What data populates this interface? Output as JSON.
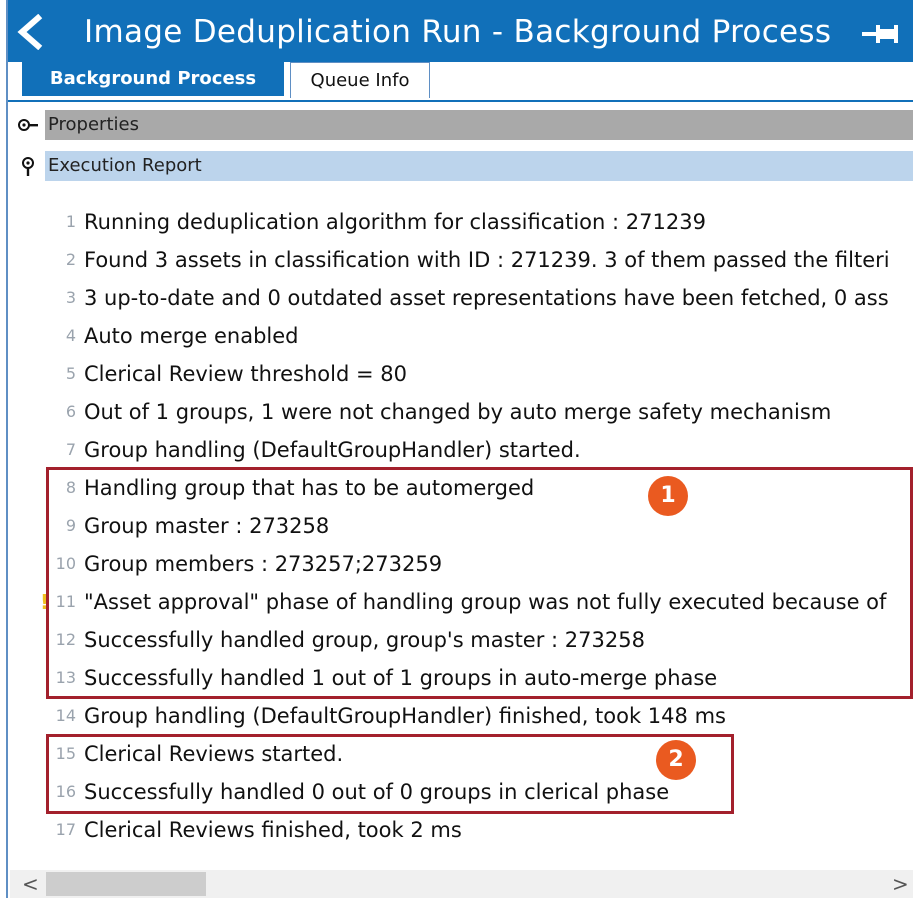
{
  "window": {
    "title": "Image Deduplication Run - Background Process"
  },
  "tabs": [
    {
      "label": "Background Process",
      "active": true
    },
    {
      "label": "Queue Info",
      "active": false
    }
  ],
  "sections": {
    "properties": {
      "label": "Properties",
      "expanded": false
    },
    "execution_report": {
      "label": "Execution Report",
      "expanded": true
    }
  },
  "report_lines": [
    {
      "num": "1",
      "text": "Running deduplication algorithm for classification : 271239"
    },
    {
      "num": "2",
      "text": "Found 3 assets in classification with ID : 271239. 3 of them passed the filteri"
    },
    {
      "num": "3",
      "text": "3 up-to-date and 0 outdated asset representations have been fetched, 0 ass"
    },
    {
      "num": "4",
      "text": "Auto merge enabled"
    },
    {
      "num": "5",
      "text": "Clerical Review threshold = 80"
    },
    {
      "num": "6",
      "text": "Out of 1 groups, 1 were not changed by auto merge safety mechanism"
    },
    {
      "num": "7",
      "text": "Group handling (DefaultGroupHandler) started."
    },
    {
      "num": "8",
      "text": "Handling group that has to be automerged"
    },
    {
      "num": "9",
      "text": "Group master : 273258"
    },
    {
      "num": "10",
      "text": "Group members : 273257;273259"
    },
    {
      "num": "11",
      "text": "\"Asset approval\" phase of handling group was not fully executed because of",
      "warning": "!"
    },
    {
      "num": "12",
      "text": "Successfully handled group, group's master : 273258"
    },
    {
      "num": "13",
      "text": "Successfully handled 1 out of 1 groups in auto-merge phase"
    },
    {
      "num": "14",
      "text": "Group handling (DefaultGroupHandler) finished, took 148 ms"
    },
    {
      "num": "15",
      "text": "Clerical Reviews started."
    },
    {
      "num": "16",
      "text": "Successfully handled 0 out of 0 groups in clerical phase"
    },
    {
      "num": "17",
      "text": "Clerical Reviews finished, took 2 ms"
    }
  ],
  "callouts": [
    {
      "label": "1"
    },
    {
      "label": "2"
    }
  ],
  "scrollbar": {
    "left_arrow": "<",
    "right_arrow": ">"
  },
  "colors": {
    "title_bar": "#1170b9",
    "highlight_box": "#a3202c",
    "badge": "#ea5a20",
    "properties_bar": "#a9a9a9",
    "execution_bar": "#bcd4ec"
  },
  "icons": {
    "back": "chevron-left-icon",
    "pin": "pin-icon",
    "properties": "collapsed-toggle-icon",
    "execution_report": "expanded-toggle-icon"
  }
}
